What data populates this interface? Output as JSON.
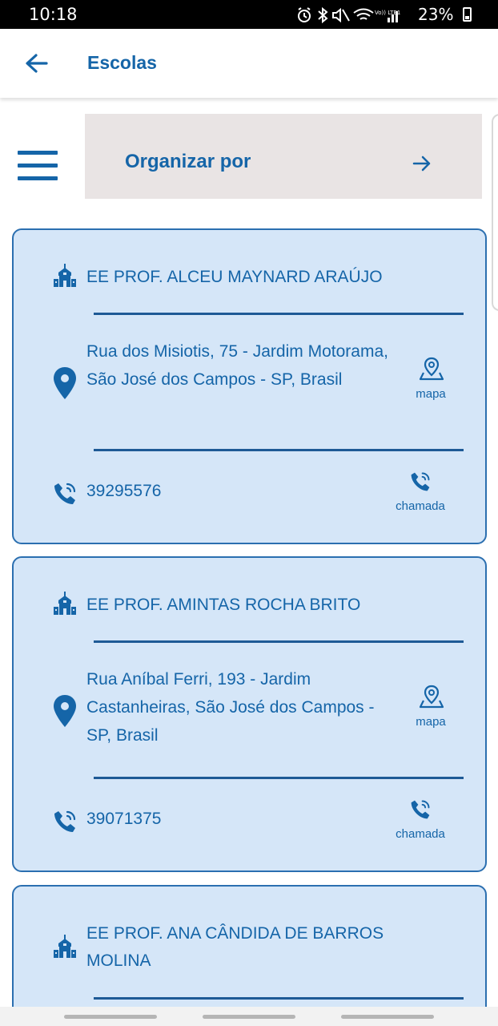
{
  "status_bar": {
    "time": "10:18",
    "battery": "23%",
    "icons": [
      "alarm-icon",
      "bluetooth-icon",
      "mute-icon",
      "wifi-icon",
      "volte-icon",
      "signal-icon",
      "battery-icon"
    ],
    "volte_label": "Vo)) LTE1"
  },
  "header": {
    "title": "Escolas",
    "back_icon": "arrow-left-icon"
  },
  "toolbar": {
    "menu_icon": "hamburger-menu-icon",
    "sort_label": "Organizar por",
    "sort_icon": "arrow-right-icon"
  },
  "schools": [
    {
      "name": "EE PROF. ALCEU MAYNARD ARAÚJO",
      "address": "Rua dos Misiotis, 75 - Jardim Motorama, São José dos Campos - SP, Brasil",
      "phone": "39295576",
      "map_label": "mapa",
      "call_label": "chamada"
    },
    {
      "name": "EE PROF. AMINTAS ROCHA BRITO",
      "address": "Rua Aníbal Ferri, 193 - Jardim Castanheiras, São José dos Campos - SP, Brasil",
      "phone": "39071375",
      "map_label": "mapa",
      "call_label": "chamada"
    },
    {
      "name": "EE PROF. ANA CÂNDIDA DE BARROS MOLINA"
    }
  ],
  "colors": {
    "primary": "#1565a8",
    "card_background": "#d5e6f8",
    "card_border": "#2b6fb0",
    "sort_background": "#e9e4e4"
  }
}
